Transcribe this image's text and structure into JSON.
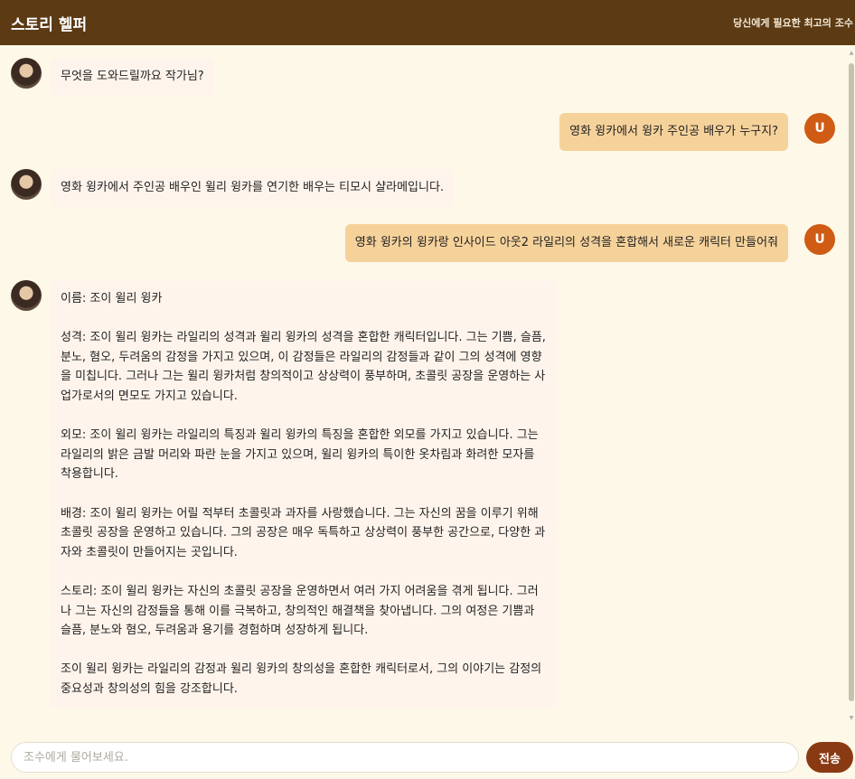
{
  "header": {
    "title": "스토리 헬퍼",
    "subtitle": "당신에게 필요한 최고의 조수"
  },
  "messages": [
    {
      "role": "bot",
      "text": "무엇을 도와드릴까요 작가님?"
    },
    {
      "role": "user",
      "avatar": "U",
      "text": "영화 윙카에서 윙카 주인공 배우가 누구지?"
    },
    {
      "role": "bot",
      "text": "영화 윙카에서 주인공 배우인 윌리 윙카를 연기한 배우는 티모시 샬라메입니다."
    },
    {
      "role": "user",
      "avatar": "U",
      "text": "영화 윙카의 윙카랑 인사이드 아웃2 라일리의 성격을 혼합해서 새로운 캐릭터 만들어줘"
    },
    {
      "role": "bot",
      "text": "이름: 조이 윌리 윙카\n\n성격: 조이 윌리 윙카는 라일리의 성격과 윌리 윙카의 성격을 혼합한 캐릭터입니다. 그는 기쁨, 슬픔, 분노, 혐오, 두려움의 감정을 가지고 있으며, 이 감정들은 라일리의 감정들과 같이 그의 성격에 영향을 미칩니다. 그러나 그는 윌리 윙카처럼 창의적이고 상상력이 풍부하며, 초콜릿 공장을 운영하는 사업가로서의 면모도 가지고 있습니다.\n\n외모: 조이 윌리 윙카는 라일리의 특징과 윌리 윙카의 특징을 혼합한 외모를 가지고 있습니다. 그는 라일리의 밝은 금발 머리와 파란 눈을 가지고 있으며, 윌리 윙카의 특이한 옷차림과 화려한 모자를 착용합니다.\n\n배경: 조이 윌리 윙카는 어릴 적부터 초콜릿과 과자를 사랑했습니다. 그는 자신의 꿈을 이루기 위해 초콜릿 공장을 운영하고 있습니다. 그의 공장은 매우 독특하고 상상력이 풍부한 공간으로, 다양한 과자와 초콜릿이 만들어지는 곳입니다.\n\n스토리: 조이 윌리 윙카는 자신의 초콜릿 공장을 운영하면서 여러 가지 어려움을 겪게 됩니다. 그러나 그는 자신의 감정들을 통해 이를 극복하고, 창의적인 해결책을 찾아냅니다. 그의 여정은 기쁨과 슬픔, 분노와 혐오, 두려움과 용기를 경험하며 성장하게 됩니다.\n\n조이 윌리 윙카는 라일리의 감정과 윌리 윙카의 창의성을 혼합한 캐릭터로서, 그의 이야기는 감정의 중요성과 창의성의 힘을 강조합니다."
    }
  ],
  "input": {
    "placeholder": "조수에게 물어보세요.",
    "value": ""
  },
  "send_label": "전송",
  "colors": {
    "header_bg": "#5b3a14",
    "page_bg": "#fdf8e8",
    "bot_bubble": "#fff4ec",
    "user_bubble": "#f6d29b",
    "user_avatar": "#cf5b14",
    "send_button": "#8a3a12"
  }
}
